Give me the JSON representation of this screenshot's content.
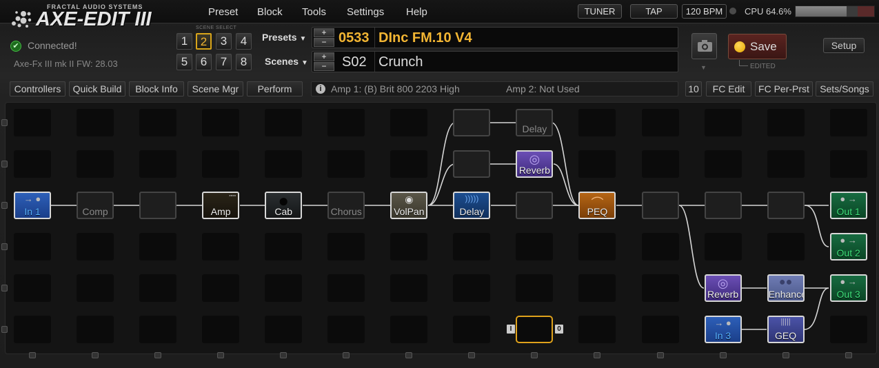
{
  "app": {
    "brand": "FRACTAL AUDIO SYSTEMS",
    "product": "AXE-EDIT III"
  },
  "menu": [
    "Preset",
    "Block",
    "Tools",
    "Settings",
    "Help"
  ],
  "toolbar": {
    "tuner": "TUNER",
    "tap": "TAP",
    "bpm": "120 BPM",
    "cpu": "CPU 64.6%",
    "cpu_fraction": 0.646
  },
  "status": {
    "connected": "Connected!",
    "firmware": "Axe-Fx III mk II FW: 28.03"
  },
  "scene_select": {
    "label": "SCENE SELECT",
    "buttons": [
      "1",
      "2",
      "3",
      "4",
      "5",
      "6",
      "7",
      "8"
    ],
    "active": "2"
  },
  "preset": {
    "label": "Presets",
    "number": "0533",
    "name": "DInc FM.10 V4",
    "color": "#f2b533"
  },
  "scene": {
    "label": "Scenes",
    "number": "S02",
    "name": "Crunch"
  },
  "save": {
    "label": "Save",
    "edited": "EDITED"
  },
  "setup_label": "Setup",
  "tabs": [
    "Controllers",
    "Quick Build",
    "Block Info",
    "Scene Mgr",
    "Perform"
  ],
  "info": {
    "amp1": "Amp 1: (B) Brit 800 2203 High",
    "amp2": "Amp 2: Not Used"
  },
  "right_tabs": [
    "10",
    "FC Edit",
    "FC Per-Prst",
    "Sets/Songs"
  ],
  "blocks": [
    {
      "name": "In 1",
      "row": 2,
      "col": 0,
      "kind": "in"
    },
    {
      "name": "Comp",
      "row": 2,
      "col": 1,
      "kind": "ghost"
    },
    {
      "name": "",
      "row": 2,
      "col": 2,
      "kind": "ghost"
    },
    {
      "name": "Amp",
      "row": 2,
      "col": 3,
      "kind": "amp"
    },
    {
      "name": "Cab",
      "row": 2,
      "col": 4,
      "kind": "cab"
    },
    {
      "name": "Chorus",
      "row": 2,
      "col": 5,
      "kind": "ghost"
    },
    {
      "name": "VolPan",
      "row": 2,
      "col": 6,
      "kind": "volpan"
    },
    {
      "name": "Delay",
      "row": 2,
      "col": 7,
      "kind": "delay"
    },
    {
      "name": "",
      "row": 2,
      "col": 8,
      "kind": "ghost"
    },
    {
      "name": "PEQ",
      "row": 2,
      "col": 9,
      "kind": "peq"
    },
    {
      "name": "",
      "row": 2,
      "col": 10,
      "kind": "ghost"
    },
    {
      "name": "",
      "row": 2,
      "col": 11,
      "kind": "ghost"
    },
    {
      "name": "",
      "row": 2,
      "col": 12,
      "kind": "ghost"
    },
    {
      "name": "Out 1",
      "row": 2,
      "col": 13,
      "kind": "out"
    },
    {
      "name": "",
      "row": 0,
      "col": 7,
      "kind": "ghost"
    },
    {
      "name": "Delay",
      "row": 0,
      "col": 8,
      "kind": "ghost"
    },
    {
      "name": "",
      "row": 1,
      "col": 7,
      "kind": "ghost"
    },
    {
      "name": "Reverb",
      "row": 1,
      "col": 8,
      "kind": "reverb"
    },
    {
      "name": "Out 2",
      "row": 3,
      "col": 13,
      "kind": "out"
    },
    {
      "name": "Reverb",
      "row": 4,
      "col": 11,
      "kind": "reverb"
    },
    {
      "name": "Enhance",
      "row": 4,
      "col": 12,
      "kind": "enhance"
    },
    {
      "name": "Out 3",
      "row": 4,
      "col": 13,
      "kind": "out"
    },
    {
      "name": "In 3",
      "row": 5,
      "col": 11,
      "kind": "in"
    },
    {
      "name": "GEQ",
      "row": 5,
      "col": 12,
      "kind": "geq"
    }
  ],
  "selection": {
    "left_tag": "I",
    "right_tag": "0"
  }
}
